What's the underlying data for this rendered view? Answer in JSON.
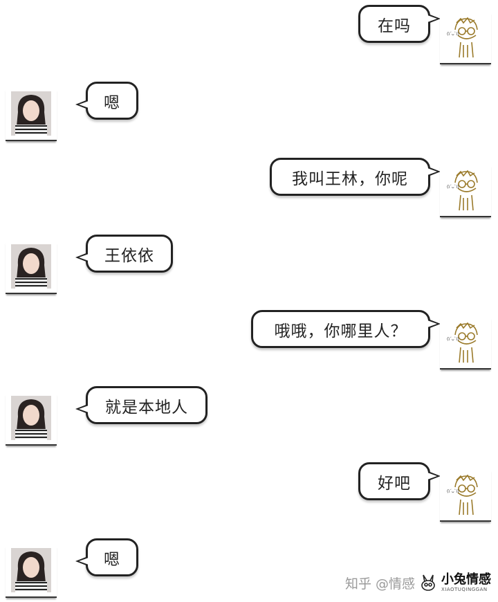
{
  "messages": [
    {
      "side": "right",
      "text": "在吗"
    },
    {
      "side": "left",
      "text": "嗯"
    },
    {
      "side": "right",
      "text": "我叫王林，你呢"
    },
    {
      "side": "left",
      "text": "王依依"
    },
    {
      "side": "right",
      "text": "哦哦，你哪里人？"
    },
    {
      "side": "left",
      "text": "就是本地人"
    },
    {
      "side": "right",
      "text": "好吧"
    },
    {
      "side": "left",
      "text": "嗯"
    }
  ],
  "watermark": {
    "zhihu": "知乎 @情感",
    "brand_cn": "小兔情感",
    "brand_en": "XIAOTUQINGGAN"
  },
  "colors": {
    "bubble_border": "#222222",
    "male_avatar_line": "#9a7a2a"
  }
}
